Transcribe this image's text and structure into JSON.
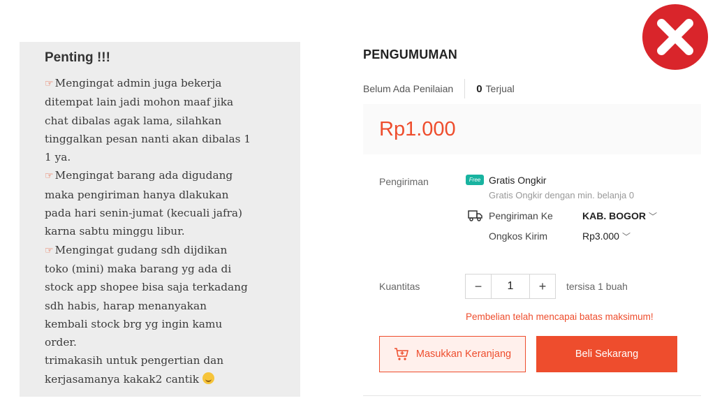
{
  "note": {
    "title": "Penting !!!",
    "lines": [
      "Mengingat admin juga bekerja",
      "ditempat lain jadi mohon maaf jika",
      "chat dibalas agak lama, silahkan",
      "tinggalkan pesan nanti akan dibalas 1",
      "1 ya.",
      "Mengingat barang ada digudang",
      "maka pengiriman hanya dlakukan",
      "pada hari senin-jumat (kecuali jafra)",
      "karna sabtu minggu libur.",
      "Mengingat gudang sdh dijdikan",
      "toko (mini) maka barang yg ada di",
      "stock app shopee bisa saja terkadang",
      "sdh habis, harap menanyakan",
      "kembali stock brg yg ingin kamu",
      "order.",
      "trimakasih untuk pengertian dan",
      "kerjasamanya kakak2 cantik"
    ]
  },
  "product": {
    "title": "PENGUMUMAN",
    "rating_text": "Belum Ada Penilaian",
    "sold_count": "0",
    "sold_label": "Terjual",
    "price": "Rp1.000"
  },
  "shipping": {
    "label": "Pengiriman",
    "free_badge": "Free",
    "free_title": "Gratis Ongkir",
    "free_sub": "Gratis Ongkir dengan min. belanja 0",
    "ship_to_label": "Pengiriman Ke",
    "ship_to_value": "KAB. BOGOR",
    "cost_label": "Ongkos Kirim",
    "cost_value": "Rp3.000"
  },
  "quantity": {
    "label": "Kuantitas",
    "minus": "−",
    "value": "1",
    "plus": "+",
    "stock": "tersisa 1 buah",
    "max_message": "Pembelian telah mencapai batas maksimum!"
  },
  "actions": {
    "add_to_cart": "Masukkan Keranjang",
    "buy_now": "Beli Sekarang"
  },
  "colors": {
    "accent": "#ee4d2d",
    "free_badge": "#18b3a0",
    "x_icon": "#d9252b"
  },
  "icons": [
    "hand-pointer-icon",
    "smile-emoji-icon",
    "free-shipping-icon",
    "truck-icon",
    "chevron-down-icon",
    "cart-add-icon",
    "close-x-icon"
  ]
}
